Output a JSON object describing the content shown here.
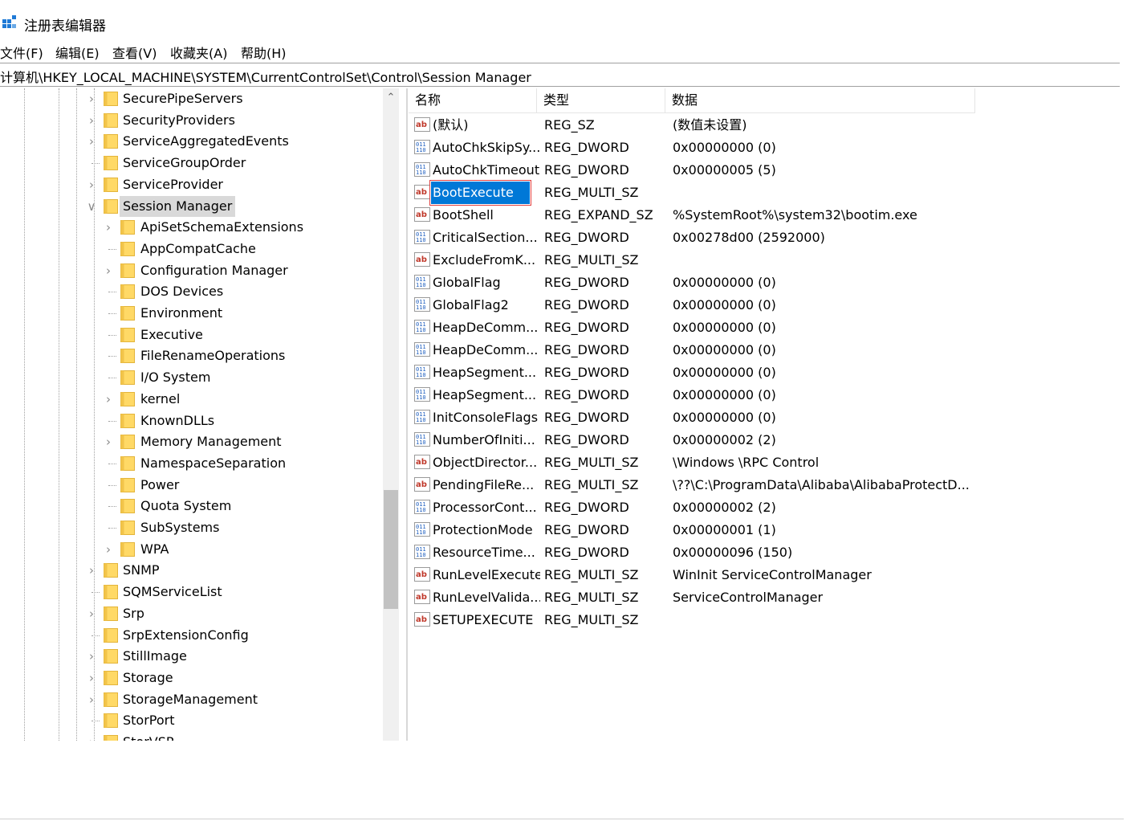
{
  "window": {
    "title": "注册表编辑器",
    "icon": "registry-icon"
  },
  "menu": [
    "文件(F)",
    "编辑(E)",
    "查看(V)",
    "收藏夹(A)",
    "帮助(H)"
  ],
  "address": "计算机\\HKEY_LOCAL_MACHINE\\SYSTEM\\CurrentControlSet\\Control\\Session Manager",
  "tree": {
    "items": [
      {
        "label": "SecurePipeServers",
        "level": 1,
        "expander": "collapsed"
      },
      {
        "label": "SecurityProviders",
        "level": 1,
        "expander": "collapsed"
      },
      {
        "label": "ServiceAggregatedEvents",
        "level": 1,
        "expander": "collapsed"
      },
      {
        "label": "ServiceGroupOrder",
        "level": 1,
        "expander": "none"
      },
      {
        "label": "ServiceProvider",
        "level": 1,
        "expander": "collapsed"
      },
      {
        "label": "Session Manager",
        "level": 1,
        "expander": "expanded",
        "selected": true
      },
      {
        "label": "ApiSetSchemaExtensions",
        "level": 2,
        "expander": "collapsed"
      },
      {
        "label": "AppCompatCache",
        "level": 2,
        "expander": "none"
      },
      {
        "label": "Configuration Manager",
        "level": 2,
        "expander": "collapsed"
      },
      {
        "label": "DOS Devices",
        "level": 2,
        "expander": "none"
      },
      {
        "label": "Environment",
        "level": 2,
        "expander": "none"
      },
      {
        "label": "Executive",
        "level": 2,
        "expander": "none"
      },
      {
        "label": "FileRenameOperations",
        "level": 2,
        "expander": "none"
      },
      {
        "label": "I/O System",
        "level": 2,
        "expander": "none"
      },
      {
        "label": "kernel",
        "level": 2,
        "expander": "collapsed"
      },
      {
        "label": "KnownDLLs",
        "level": 2,
        "expander": "none"
      },
      {
        "label": "Memory Management",
        "level": 2,
        "expander": "collapsed"
      },
      {
        "label": "NamespaceSeparation",
        "level": 2,
        "expander": "none"
      },
      {
        "label": "Power",
        "level": 2,
        "expander": "none"
      },
      {
        "label": "Quota System",
        "level": 2,
        "expander": "none"
      },
      {
        "label": "SubSystems",
        "level": 2,
        "expander": "none"
      },
      {
        "label": "WPA",
        "level": 2,
        "expander": "collapsed"
      },
      {
        "label": "SNMP",
        "level": 1,
        "expander": "collapsed"
      },
      {
        "label": "SQMServiceList",
        "level": 1,
        "expander": "none"
      },
      {
        "label": "Srp",
        "level": 1,
        "expander": "collapsed"
      },
      {
        "label": "SrpExtensionConfig",
        "level": 1,
        "expander": "none"
      },
      {
        "label": "StillImage",
        "level": 1,
        "expander": "collapsed"
      },
      {
        "label": "Storage",
        "level": 1,
        "expander": "collapsed"
      },
      {
        "label": "StorageManagement",
        "level": 1,
        "expander": "collapsed"
      },
      {
        "label": "StorPort",
        "level": 1,
        "expander": "none"
      },
      {
        "label": "StorVSP",
        "level": 1,
        "expander": "collapsed"
      }
    ]
  },
  "list": {
    "columns": [
      "名称",
      "类型",
      "数据"
    ],
    "rows": [
      {
        "name": "(默认)",
        "type": "REG_SZ",
        "data": "(数值未设置)",
        "icon": "string"
      },
      {
        "name": "AutoChkSkipSy...",
        "type": "REG_DWORD",
        "data": "0x00000000 (0)",
        "icon": "binary"
      },
      {
        "name": "AutoChkTimeout",
        "type": "REG_DWORD",
        "data": "0x00000005 (5)",
        "icon": "binary"
      },
      {
        "name": "BootExecute",
        "type": "REG_MULTI_SZ",
        "data": "",
        "icon": "string",
        "selected": true
      },
      {
        "name": "BootShell",
        "type": "REG_EXPAND_SZ",
        "data": "%SystemRoot%\\system32\\bootim.exe",
        "icon": "string"
      },
      {
        "name": "CriticalSection...",
        "type": "REG_DWORD",
        "data": "0x00278d00 (2592000)",
        "icon": "binary"
      },
      {
        "name": "ExcludeFromK...",
        "type": "REG_MULTI_SZ",
        "data": "",
        "icon": "string"
      },
      {
        "name": "GlobalFlag",
        "type": "REG_DWORD",
        "data": "0x00000000 (0)",
        "icon": "binary"
      },
      {
        "name": "GlobalFlag2",
        "type": "REG_DWORD",
        "data": "0x00000000 (0)",
        "icon": "binary"
      },
      {
        "name": "HeapDeComm...",
        "type": "REG_DWORD",
        "data": "0x00000000 (0)",
        "icon": "binary"
      },
      {
        "name": "HeapDeComm...",
        "type": "REG_DWORD",
        "data": "0x00000000 (0)",
        "icon": "binary"
      },
      {
        "name": "HeapSegment...",
        "type": "REG_DWORD",
        "data": "0x00000000 (0)",
        "icon": "binary"
      },
      {
        "name": "HeapSegment...",
        "type": "REG_DWORD",
        "data": "0x00000000 (0)",
        "icon": "binary"
      },
      {
        "name": "InitConsoleFlags",
        "type": "REG_DWORD",
        "data": "0x00000000 (0)",
        "icon": "binary"
      },
      {
        "name": "NumberOfIniti...",
        "type": "REG_DWORD",
        "data": "0x00000002 (2)",
        "icon": "binary"
      },
      {
        "name": "ObjectDirector...",
        "type": "REG_MULTI_SZ",
        "data": "\\Windows \\RPC Control",
        "icon": "string"
      },
      {
        "name": "PendingFileRe...",
        "type": "REG_MULTI_SZ",
        "data": "\\??\\C:\\ProgramData\\Alibaba\\AlibabaProtectD...",
        "icon": "string"
      },
      {
        "name": "ProcessorCont...",
        "type": "REG_DWORD",
        "data": "0x00000002 (2)",
        "icon": "binary"
      },
      {
        "name": "ProtectionMode",
        "type": "REG_DWORD",
        "data": "0x00000001 (1)",
        "icon": "binary"
      },
      {
        "name": "ResourceTime...",
        "type": "REG_DWORD",
        "data": "0x00000096 (150)",
        "icon": "binary"
      },
      {
        "name": "RunLevelExecute",
        "type": "REG_MULTI_SZ",
        "data": "WinInit ServiceControlManager",
        "icon": "string"
      },
      {
        "name": "RunLevelValida...",
        "type": "REG_MULTI_SZ",
        "data": "ServiceControlManager",
        "icon": "string"
      },
      {
        "name": "SETUPEXECUTE",
        "type": "REG_MULTI_SZ",
        "data": "",
        "icon": "string"
      }
    ]
  },
  "colors": {
    "selection": "#0078d7",
    "folder": "#ffd966",
    "tree_selected": "#d9d9d9",
    "focus_outline": "#e04040"
  }
}
